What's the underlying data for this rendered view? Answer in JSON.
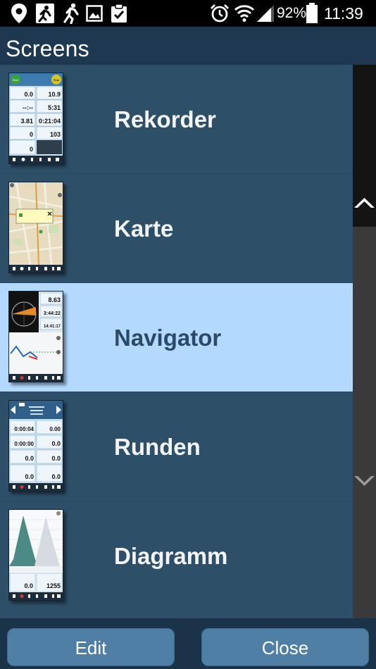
{
  "status_bar": {
    "battery_percent": "92%",
    "time": "11:39",
    "notification_icons": [
      "location-pin-icon",
      "runner-app-icon",
      "running-icon",
      "image-icon",
      "clipboard-check-icon"
    ],
    "system_icons": [
      "alarm-icon",
      "wifi-icon",
      "signal-icon",
      "battery-icon"
    ]
  },
  "header": {
    "title": "Screens"
  },
  "screens": [
    {
      "label": "Rekorder",
      "selected": false,
      "thumb": {
        "badges": [
          "Start",
          "Stop"
        ],
        "values": [
          "0.0",
          "10.9",
          "--:--",
          "5:31",
          "3.81",
          "0:21:04",
          "0",
          "103",
          "0"
        ]
      }
    },
    {
      "label": "Karte",
      "selected": false,
      "thumb": {}
    },
    {
      "label": "Navigator",
      "selected": true,
      "thumb": {
        "values": [
          "8.63",
          "3:44:22",
          "14:41:17"
        ]
      }
    },
    {
      "label": "Runden",
      "selected": false,
      "thumb": {
        "values": [
          "0:00:04",
          "0.00",
          "0:00:00",
          "0.0",
          "0.0",
          "0.0",
          "0.0",
          "0.0"
        ]
      }
    },
    {
      "label": "Diagramm",
      "selected": false,
      "thumb": {
        "values": [
          "0.0",
          "1255"
        ]
      }
    }
  ],
  "buttons": {
    "edit": "Edit",
    "close": "Close"
  },
  "colors": {
    "list_bg": "#2e4f68",
    "selected_bg": "#b3d9ff",
    "button_bg": "#4f7fa5",
    "header_bg": "#1d3850"
  }
}
